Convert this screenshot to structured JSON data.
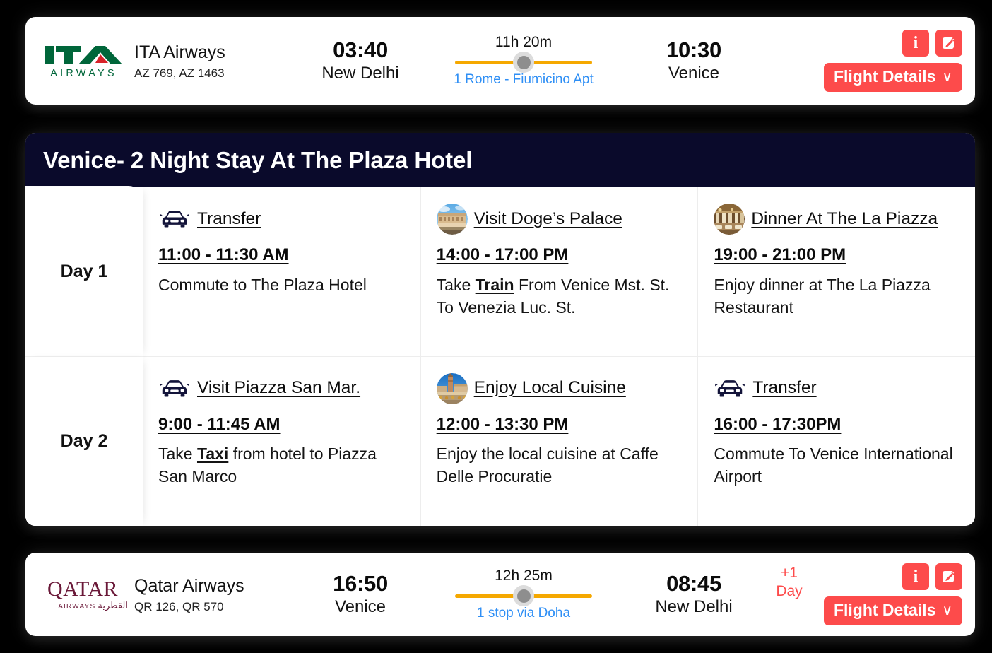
{
  "outbound_flight": {
    "airline": "ITA Airways",
    "logo_text": "ITA",
    "logo_subtext": "AIRWAYS",
    "flight_numbers": "AZ 769, AZ 1463",
    "depart_time": "03:40",
    "depart_city": "New Delhi",
    "duration": "11h 20m",
    "stops": "1 Rome - Fiumicino Apt",
    "arrive_time": "10:30",
    "arrive_city": "Venice",
    "day_offset": "",
    "info_icon": "info-icon",
    "edit_icon": "edit-icon",
    "details_label": "Flight Details",
    "details_chevron": "∨"
  },
  "return_flight": {
    "airline": "Qatar Airways",
    "logo_text": "QATAR",
    "logo_subtext": "AIRWAYS",
    "logo_subtext_ar": "القطرية",
    "flight_numbers": "QR 126, QR 570",
    "depart_time": "16:50",
    "depart_city": "Venice",
    "duration": "12h 25m",
    "stops": "1 stop via Doha",
    "arrive_time": "08:45",
    "arrive_city": "New Delhi",
    "day_offset_num": "+1",
    "day_offset_unit": "Day",
    "info_icon": "info-icon",
    "edit_icon": "edit-icon",
    "details_label": "Flight Details",
    "details_chevron": "∨"
  },
  "itinerary": {
    "title": "Venice- 2 Night Stay At The Plaza Hotel",
    "days": [
      {
        "label": "Day 1"
      },
      {
        "label": "Day 2"
      }
    ],
    "activities": [
      {
        "day": "Day 1",
        "icon": "car-icon",
        "title": "Transfer",
        "time": "11:00 - 11:30 AM",
        "desc_before": "Commute to The Plaza Hotel",
        "desc_bold": "",
        "desc_after": ""
      },
      {
        "day": "Day 1",
        "icon": "doges-palace-photo",
        "title": "Visit Doge’s Palace",
        "time": "14:00 - 17:00 PM",
        "desc_before": "Take ",
        "desc_bold": "Train",
        "desc_after": " From Venice Mst. St. To Venezia Luc. St."
      },
      {
        "day": "Day 1",
        "icon": "la-piazza-photo",
        "title": "Dinner At The La Piazza",
        "time": "19:00 - 21:00 PM",
        "desc_before": "Enjoy dinner at The La Piazza Restaurant",
        "desc_bold": "",
        "desc_after": ""
      },
      {
        "day": "Day 2",
        "icon": "car-icon",
        "title": "Visit Piazza San Mar.",
        "time": "9:00 - 11:45 AM",
        "desc_before": "Take ",
        "desc_bold": "Taxi",
        "desc_after": " from hotel to Piazza San Marco"
      },
      {
        "day": "Day 2",
        "icon": "piazza-san-marco-photo",
        "title": "Enjoy Local Cuisine",
        "time": "12:00 - 13:30 PM",
        "desc_before": "Enjoy the local cuisine at Caffe Delle Procuratie",
        "desc_bold": "",
        "desc_after": ""
      },
      {
        "day": "Day 2",
        "icon": "car-icon",
        "title": "Transfer",
        "time": "16:00 - 17:30PM",
        "desc_before": "Commute To Venice International Airport",
        "desc_bold": "",
        "desc_after": ""
      }
    ]
  },
  "colors": {
    "accent_red": "#fd4b4b",
    "navy": "#0a0a2b",
    "amber": "#f5a800",
    "link_blue": "#2f8ff5",
    "ita_green": "#00663a",
    "qatar_maroon": "#6a1838"
  }
}
